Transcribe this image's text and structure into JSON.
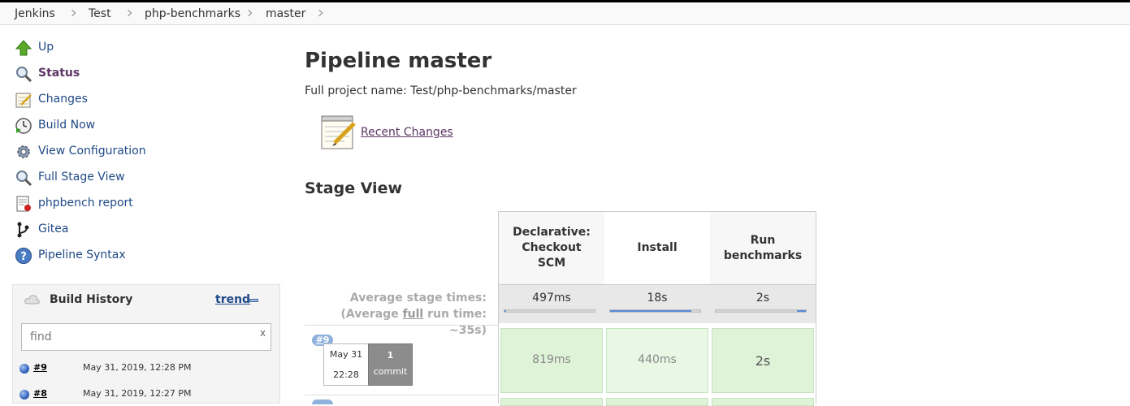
{
  "breadcrumbs": [
    "Jenkins",
    "Test",
    "php-benchmarks",
    "master"
  ],
  "sidebar": {
    "items": [
      {
        "label": "Up",
        "icon": "up-arrow-icon"
      },
      {
        "label": "Status",
        "icon": "magnifier-icon",
        "active": true
      },
      {
        "label": "Changes",
        "icon": "notepad-icon"
      },
      {
        "label": "Build Now",
        "icon": "clock-play-icon"
      },
      {
        "label": "View Configuration",
        "icon": "gear-icon"
      },
      {
        "label": "Full Stage View",
        "icon": "magnifier-icon"
      },
      {
        "label": "phpbench report",
        "icon": "report-icon"
      },
      {
        "label": "Gitea",
        "icon": "git-branch-icon"
      },
      {
        "label": "Pipeline Syntax",
        "icon": "help-icon"
      }
    ]
  },
  "build_history": {
    "title": "Build History",
    "trend_label": "trend",
    "find_placeholder": "find",
    "clear_label": "x",
    "builds": [
      {
        "number": "#9",
        "date": "May 31, 2019, 12:28 PM"
      },
      {
        "number": "#8",
        "date": "May 31, 2019, 12:27 PM"
      }
    ]
  },
  "main": {
    "title": "Pipeline master",
    "full_name": "Full project name: Test/php-benchmarks/master",
    "recent_changes": "Recent Changes",
    "stage_view_title": "Stage View"
  },
  "stage_view": {
    "avg_label_1": "Average stage times:",
    "avg_label_2a": "(Average ",
    "avg_label_2b": "full",
    "avg_label_2c": " run time: ~35s)",
    "stages": [
      {
        "name_lines": [
          "Declarative:",
          "Checkout",
          "SCM"
        ],
        "avg": "497ms",
        "avg_fraction": 0.02
      },
      {
        "name_lines": [
          "Install"
        ],
        "avg": "18s",
        "avg_fraction": 0.9
      },
      {
        "name_lines": [
          "Run",
          "benchmarks"
        ],
        "avg": "2s",
        "avg_fraction": 0.1
      }
    ],
    "runs": [
      {
        "badge": "#9",
        "date": "May 31",
        "time": "22:28",
        "commits": "1",
        "commits_label": "commit",
        "durations": [
          "819ms",
          "440ms",
          "2s"
        ]
      }
    ]
  },
  "colors": {
    "link": "#204a87",
    "visited_link": "#5c3566",
    "success_cell": "#dff3d9",
    "progress_fill": "#5b8ad8"
  }
}
